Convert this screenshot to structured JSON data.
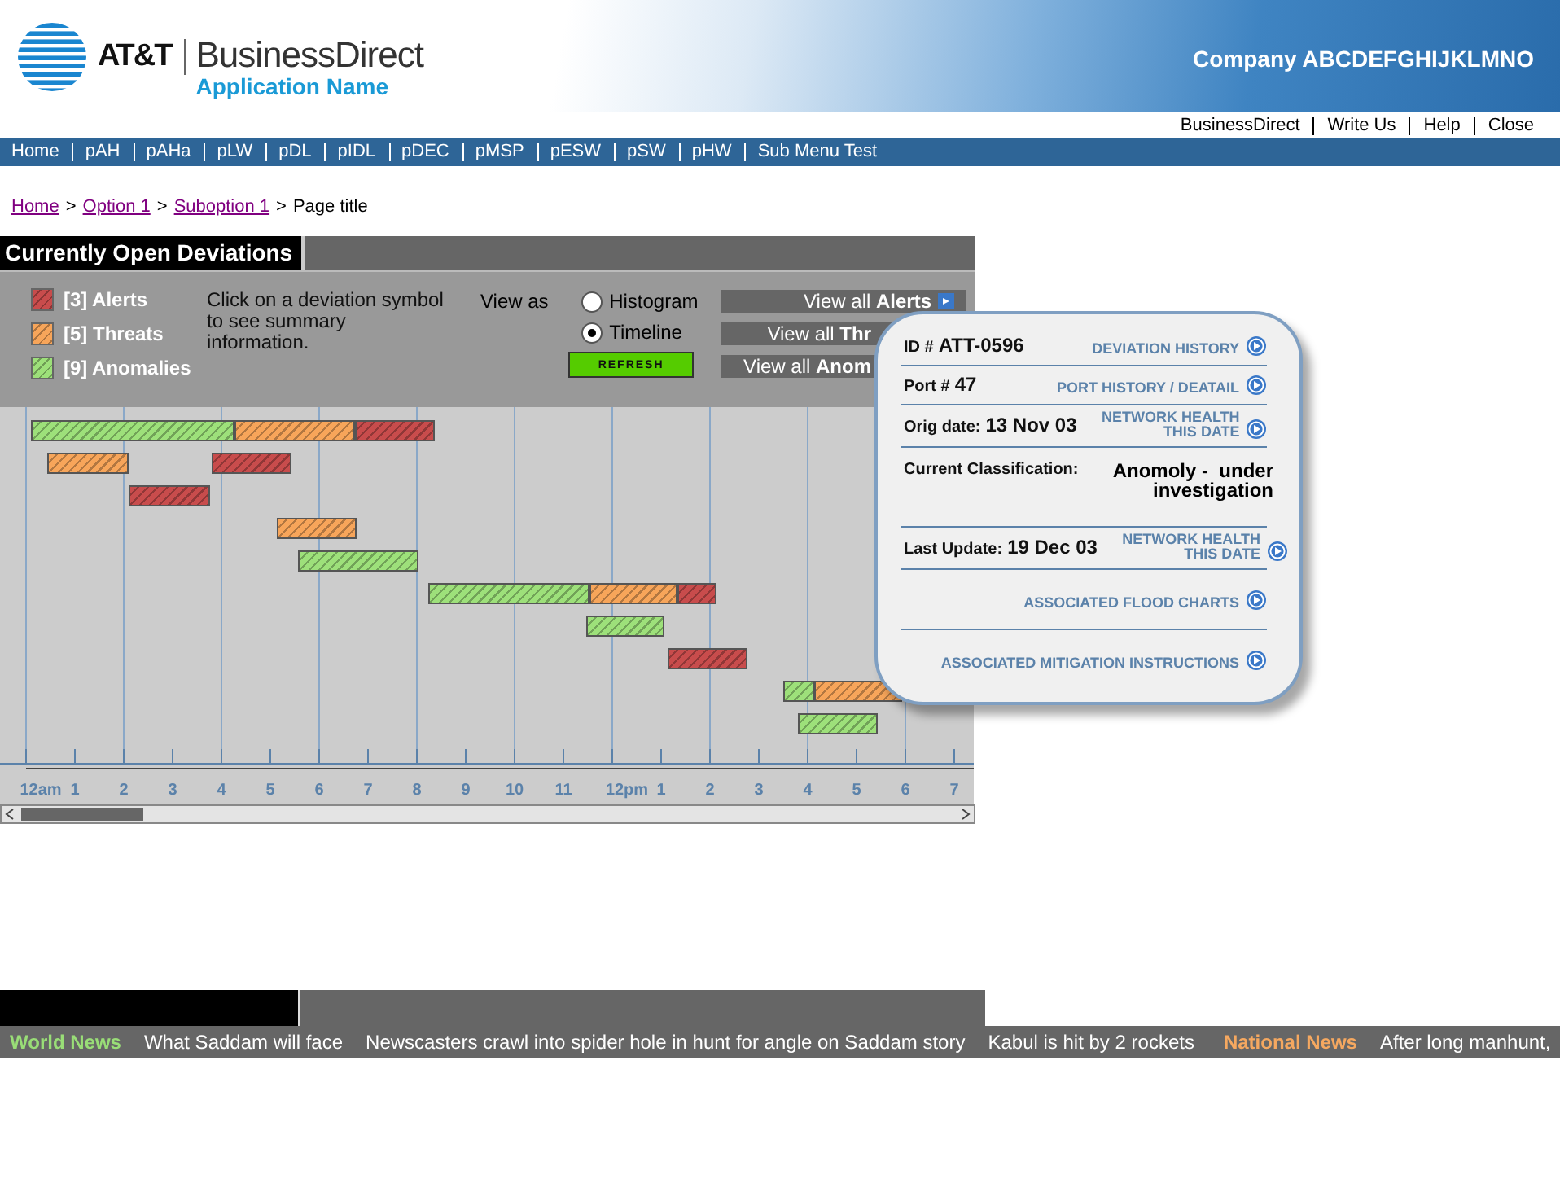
{
  "header": {
    "brand": "AT&T",
    "product": "BusinessDirect",
    "app_name": "Application Name",
    "company": "Company ABCDEFGHIJKLMNO"
  },
  "top_links": [
    "BusinessDirect",
    "Write Us",
    "Help",
    "Close"
  ],
  "nav": [
    "Home",
    "pAH",
    "pAHa",
    "pLW",
    "pDL",
    "pIDL",
    "pDEC",
    "pMSP",
    "pESW",
    "pSW",
    "pHW",
    "Sub Menu Test"
  ],
  "breadcrumb": [
    {
      "kind": "link",
      "label": "Home"
    },
    {
      "kind": "separator",
      "label": ">"
    },
    {
      "kind": "link",
      "label": "Option 1"
    },
    {
      "kind": "separator",
      "label": ">"
    },
    {
      "kind": "link",
      "label": "Suboption 1"
    },
    {
      "kind": "separator",
      "label": ">"
    },
    {
      "kind": "current",
      "label": "Page title"
    }
  ],
  "panel": {
    "title": "Currently Open Deviations",
    "legend": [
      {
        "label": "[3] Alerts",
        "color": "#c84c4c"
      },
      {
        "label": "[5] Threats",
        "color": "#f7a55a"
      },
      {
        "label": "[9] Anomalies",
        "color": "#9de07a"
      }
    ],
    "instruction": "Click on a deviation symbol to see summary information.",
    "view_as": {
      "label": "View as",
      "options": [
        {
          "label": "Histogram",
          "selected": false
        },
        {
          "label": "Timeline",
          "selected": true
        }
      ]
    },
    "refresh": "REFRESH",
    "view_all": [
      "View all **Alerts**",
      "View all **Thr**",
      "View all **Anom**"
    ],
    "timeline": {
      "axis_labels": [
        "12am",
        "1",
        "2",
        "3",
        "4",
        "5",
        "6",
        "7",
        "8",
        "9",
        "10",
        "11",
        "12pm",
        "1",
        "2",
        "3",
        "4",
        "5",
        "6",
        "7"
      ]
    }
  },
  "detail": {
    "rows": [
      {
        "kind": "field",
        "label": "ID #",
        "value": "ATT-0596",
        "link": "DEVIATION HISTORY"
      },
      {
        "kind": "field",
        "label": "Port #",
        "value": "47",
        "link": "PORT HISTORY / DEATAIL"
      },
      {
        "kind": "field",
        "label": "Orig date:",
        "value": "13 Nov 03",
        "link": "NETWORK HEALTH THIS DATE"
      },
      {
        "kind": "classification",
        "label": "Current Classification:",
        "value": "Anomoly -  under investigation"
      },
      {
        "kind": "field",
        "label": "Last Update:",
        "value": "19 Dec 03",
        "link": "NETWORK HEALTH THIS DATE"
      },
      {
        "kind": "link",
        "link": "ASSOCIATED FLOOD CHARTS"
      },
      {
        "kind": "link",
        "link": "ASSOCIATED MITIGATION INSTRUCTIONS"
      }
    ]
  },
  "ticker": [
    {
      "kind": "section",
      "text": "World News",
      "color": "#99dd77"
    },
    {
      "kind": "headline",
      "text": "What Saddam will face"
    },
    {
      "kind": "headline",
      "text": "Newscasters crawl into spider hole in hunt for angle on Saddam story"
    },
    {
      "kind": "headline",
      "text": "Kabul is hit by 2 rockets"
    },
    {
      "kind": "section",
      "text": "National News",
      "color": "#f5a860"
    },
    {
      "kind": "headline",
      "text": "After long manhunt,"
    }
  ]
}
